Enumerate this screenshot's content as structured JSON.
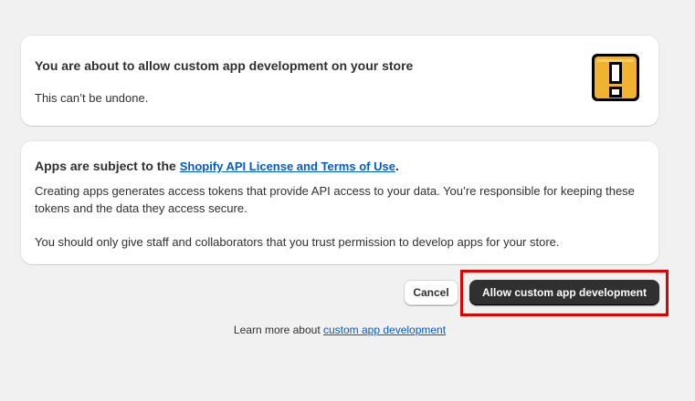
{
  "warning_card": {
    "title": "You are about to allow custom app development on your store",
    "subtitle": "This can’t be undone.",
    "icon": "warning-exclamation-icon",
    "icon_color": "#f0b231"
  },
  "terms_card": {
    "title_prefix": "Apps are subject to the ",
    "title_link": "Shopify API License and Terms of Use",
    "title_suffix": ".",
    "paragraph1": "Creating apps generates access tokens that provide API access to your data. You’re responsible for keeping these tokens and the data they access secure.",
    "paragraph2": "You should only give staff and collaborators that you trust permission to develop apps for your store."
  },
  "actions": {
    "cancel_label": "Cancel",
    "allow_label": "Allow custom app development"
  },
  "footer": {
    "prefix": "Learn more about ",
    "link": "custom app development"
  },
  "colors": {
    "link": "#005bd3",
    "primary_button": "#303030",
    "highlight": "#e00000"
  }
}
